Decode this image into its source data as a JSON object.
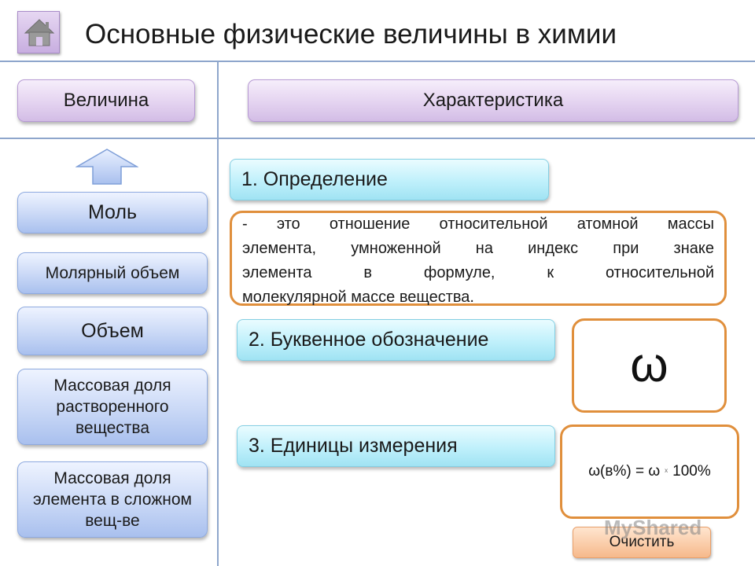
{
  "header": {
    "title": "Основные физические величины в химии",
    "home_icon": "home-icon"
  },
  "columns": {
    "quantity_label": "Величина",
    "characteristic_label": "Характеристика"
  },
  "nav": {
    "up_icon": "arrow-up-icon",
    "items": [
      {
        "label": "Моль"
      },
      {
        "label": "Молярный объем"
      },
      {
        "label": "Объем"
      },
      {
        "label": "Массовая доля растворенного вещества"
      },
      {
        "label": "Массовая доля элемента в сложном вещ-ве"
      }
    ]
  },
  "details": {
    "definition_label": "1. Определение",
    "definition_text_lines": [
      "- это отношение относительной атомной массы",
      "элемента, умноженной на индекс при знаке",
      "элемента в формуле, к относительной",
      "молекулярной массе вещества."
    ],
    "symbol_label": "2. Буквенное обозначение",
    "symbol_value": "ω",
    "units_label": "3. Единицы измерения",
    "units_formula_left": "ω(в%) = ω",
    "units_formula_op": "x",
    "units_formula_right": "100%"
  },
  "actions": {
    "clear_label": "Очистить"
  },
  "watermark": "MyShared",
  "colors": {
    "grid_line": "#8ea6cc",
    "orange_border": "#e08f3c",
    "lavender": "#e4d3f0",
    "blue_button": "#c9d8f6",
    "cyan_label": "#bff0fb"
  }
}
